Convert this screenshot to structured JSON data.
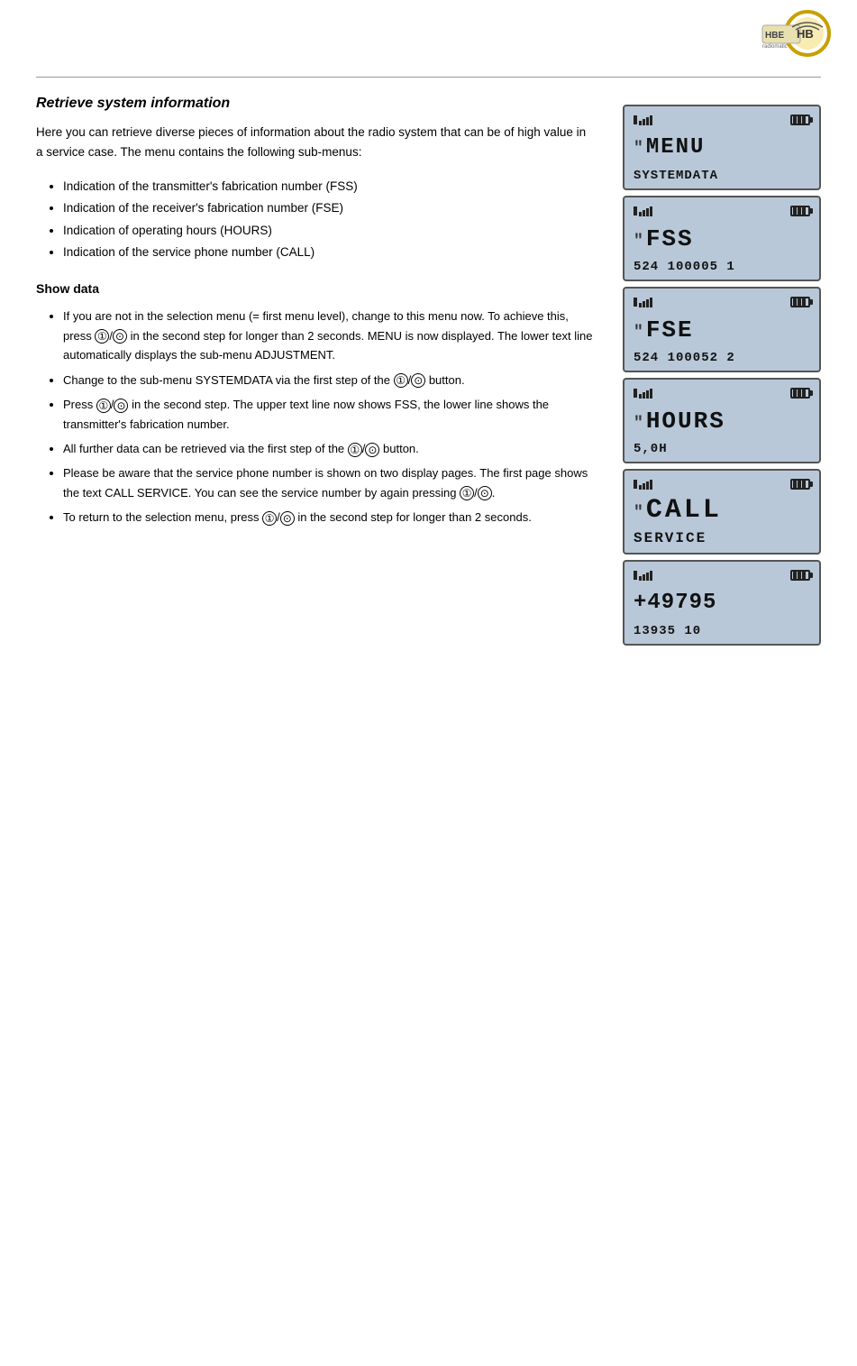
{
  "logo": {
    "alt": "HBE radiomatic logo"
  },
  "page": {
    "title": "Retrieve system information",
    "intro": "Here you can retrieve diverse pieces of information about the radio system that can be of high value in a service case. The menu contains the following sub-menus:",
    "bullets": [
      "Indication of the transmitter's fabrication number (FSS)",
      "Indication of the receiver's fabrication number (FSE)",
      "Indication of operating hours (HOURS)",
      "Indication of the service phone number (CALL)"
    ],
    "show_data_heading": "Show data",
    "steps": [
      "If you are not in the selection menu (= first menu level), change to this menu now. To achieve this, press ①/⊙ in the second step for longer than 2 seconds. MENU is now displayed. The lower text line automatically displays the sub-menu ADJUSTMENT.",
      "Change to the sub-menu SYSTEMDATA via the first step of the ①/⊙ button.",
      "Press ①/⊙ in the second step. The upper text line now shows FSS, the lower line shows the transmitter's fabrication number.",
      "All further data can be retrieved via the first step of the ①/⊙ button.",
      "Please be aware that the service phone number is shown on two display pages. The first page shows the text CALL SERVICE. You can see the service number by again pressing ①/⊙.",
      "To return to the selection menu, press ①/⊙ in the second step for longer than 2 seconds."
    ]
  },
  "screens": [
    {
      "id": "menu",
      "line1": "MENU",
      "line2": "SYSTEMDATA",
      "has_quote": true
    },
    {
      "id": "fss",
      "line1": "FSS",
      "line2": "524 100005 1",
      "has_quote": true
    },
    {
      "id": "fse",
      "line1": "FSE",
      "line2": "524 100052 2",
      "has_quote": true
    },
    {
      "id": "hours",
      "line1": "HOURS",
      "line2": "5,0H",
      "has_quote": true
    },
    {
      "id": "call",
      "line1": "CALL",
      "line2": "SERVICE",
      "has_quote": true
    },
    {
      "id": "phone",
      "line1": "+49795",
      "line2": "13935 10",
      "has_quote": false
    }
  ]
}
